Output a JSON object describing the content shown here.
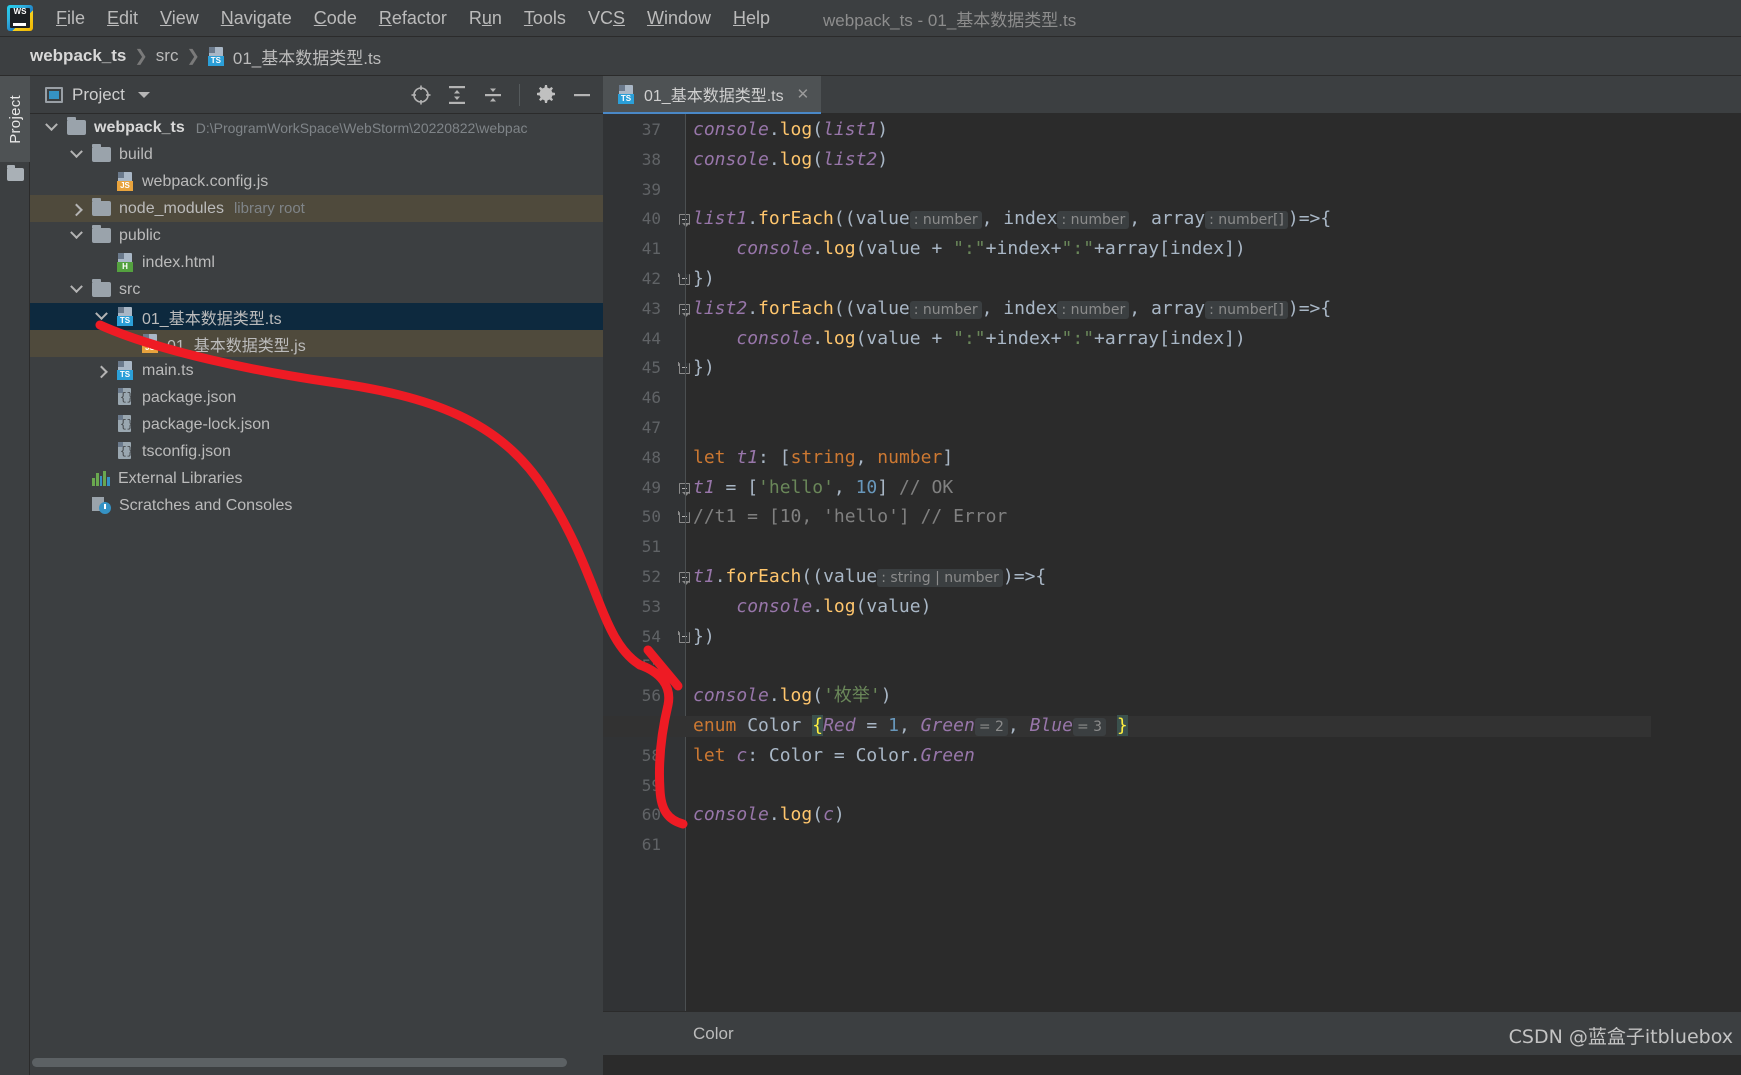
{
  "window": {
    "title": "webpack_ts - 01_基本数据类型.ts",
    "logo_text": "WS"
  },
  "menubar": {
    "items": [
      {
        "label": "File",
        "accel": "F"
      },
      {
        "label": "Edit",
        "accel": "E"
      },
      {
        "label": "View",
        "accel": "V"
      },
      {
        "label": "Navigate",
        "accel": "N"
      },
      {
        "label": "Code",
        "accel": "C"
      },
      {
        "label": "Refactor",
        "accel": "R"
      },
      {
        "label": "Run",
        "accel": "u"
      },
      {
        "label": "Tools",
        "accel": "T"
      },
      {
        "label": "VCS",
        "accel": "S"
      },
      {
        "label": "Window",
        "accel": "W"
      },
      {
        "label": "Help",
        "accel": "H"
      }
    ]
  },
  "breadcrumb": {
    "project": "webpack_ts",
    "folder": "src",
    "file": "01_基本数据类型.ts",
    "separator": "❯"
  },
  "tool_stripe": {
    "project_tab": "Project"
  },
  "project_panel": {
    "title": "Project",
    "tree": [
      {
        "indent": 0,
        "arrow": "down",
        "icon": "folder",
        "label": "webpack_ts",
        "bold": true,
        "path": "D:\\ProgramWorkSpace\\WebStorm\\20220822\\webpac",
        "state": "normal"
      },
      {
        "indent": 1,
        "arrow": "down",
        "icon": "folder",
        "label": "build",
        "bold": false,
        "state": "normal"
      },
      {
        "indent": 2,
        "arrow": "none",
        "icon": "js",
        "label": "webpack.config.js",
        "bold": false,
        "state": "normal"
      },
      {
        "indent": 1,
        "arrow": "right",
        "icon": "folder",
        "label": "node_modules",
        "bold": false,
        "sublabel": "library root",
        "state": "ghost"
      },
      {
        "indent": 1,
        "arrow": "down",
        "icon": "folder",
        "label": "public",
        "bold": false,
        "state": "normal"
      },
      {
        "indent": 2,
        "arrow": "none",
        "icon": "html",
        "label": "index.html",
        "bold": false,
        "state": "normal"
      },
      {
        "indent": 1,
        "arrow": "down",
        "icon": "folder",
        "label": "src",
        "bold": false,
        "state": "normal"
      },
      {
        "indent": 2,
        "arrow": "down",
        "icon": "ts",
        "label": "01_基本数据类型.ts",
        "bold": false,
        "state": "selected"
      },
      {
        "indent": 3,
        "arrow": "none",
        "icon": "js",
        "label": "01_基本数据类型.js",
        "bold": false,
        "state": "ghost"
      },
      {
        "indent": 2,
        "arrow": "right",
        "icon": "ts",
        "label": "main.ts",
        "bold": false,
        "state": "normal"
      },
      {
        "indent": 2,
        "arrow": "none",
        "icon": "json",
        "label": "package.json",
        "bold": false,
        "state": "normal"
      },
      {
        "indent": 2,
        "arrow": "none",
        "icon": "json",
        "label": "package-lock.json",
        "bold": false,
        "state": "normal"
      },
      {
        "indent": 2,
        "arrow": "none",
        "icon": "json",
        "label": "tsconfig.json",
        "bold": false,
        "state": "normal"
      },
      {
        "indent": 1,
        "arrow": "none",
        "icon": "extlib",
        "label": "External Libraries",
        "bold": false,
        "state": "normal"
      },
      {
        "indent": 1,
        "arrow": "none",
        "icon": "scratch",
        "label": "Scratches and Consoles",
        "bold": false,
        "state": "normal"
      }
    ],
    "toolbar_icons": [
      {
        "name": "locate-icon"
      },
      {
        "name": "expand-all-icon"
      },
      {
        "name": "collapse-all-icon"
      },
      {
        "name": "settings-gear-icon"
      },
      {
        "name": "hide-panel-icon"
      }
    ]
  },
  "editor": {
    "tab": {
      "label": "01_基本数据类型.ts",
      "close": "✕",
      "icon": "ts"
    },
    "first_line": 37,
    "current_line": 57,
    "last_line": 61,
    "bottom_breadcrumb": "Color",
    "watermark": "CSDN @蓝盒子itbluebox",
    "lines": [
      {
        "n": 37,
        "fold": "none",
        "tokens": [
          {
            "t": "console",
            "c": "inst"
          },
          {
            "t": ".",
            "c": "punct"
          },
          {
            "t": "log",
            "c": "fn"
          },
          {
            "t": "(",
            "c": "punct"
          },
          {
            "t": "list1",
            "c": "var"
          },
          {
            "t": ")",
            "c": "punct"
          }
        ]
      },
      {
        "n": 38,
        "fold": "none",
        "tokens": [
          {
            "t": "console",
            "c": "inst"
          },
          {
            "t": ".",
            "c": "punct"
          },
          {
            "t": "log",
            "c": "fn"
          },
          {
            "t": "(",
            "c": "punct"
          },
          {
            "t": "list2",
            "c": "var"
          },
          {
            "t": ")",
            "c": "punct"
          }
        ]
      },
      {
        "n": 39,
        "fold": "none",
        "tokens": []
      },
      {
        "n": 40,
        "fold": "open",
        "tokens": [
          {
            "t": "list1",
            "c": "var"
          },
          {
            "t": ".",
            "c": "punct"
          },
          {
            "t": "forEach",
            "c": "fn"
          },
          {
            "t": "((",
            "c": "punct"
          },
          {
            "t": "value",
            "c": "id"
          },
          {
            "t": ": number",
            "c": "hint"
          },
          {
            "t": ", ",
            "c": "punct"
          },
          {
            "t": "index",
            "c": "id"
          },
          {
            "t": ": number",
            "c": "hint"
          },
          {
            "t": ", ",
            "c": "punct"
          },
          {
            "t": "array",
            "c": "id"
          },
          {
            "t": ": number[]",
            "c": "hint"
          },
          {
            "t": ")=>{",
            "c": "punct"
          }
        ]
      },
      {
        "n": 41,
        "fold": "none",
        "tokens": [
          {
            "t": "    ",
            "c": "punct"
          },
          {
            "t": "console",
            "c": "inst"
          },
          {
            "t": ".",
            "c": "punct"
          },
          {
            "t": "log",
            "c": "fn"
          },
          {
            "t": "(",
            "c": "punct"
          },
          {
            "t": "value",
            "c": "id"
          },
          {
            "t": " + ",
            "c": "punct"
          },
          {
            "t": "\":\"",
            "c": "str"
          },
          {
            "t": "+",
            "c": "punct"
          },
          {
            "t": "index",
            "c": "id"
          },
          {
            "t": "+",
            "c": "punct"
          },
          {
            "t": "\":\"",
            "c": "str"
          },
          {
            "t": "+",
            "c": "punct"
          },
          {
            "t": "array",
            "c": "id"
          },
          {
            "t": "[",
            "c": "punct"
          },
          {
            "t": "index",
            "c": "id"
          },
          {
            "t": "])",
            "c": "punct"
          }
        ]
      },
      {
        "n": 42,
        "fold": "end",
        "tokens": [
          {
            "t": "})",
            "c": "punct"
          }
        ]
      },
      {
        "n": 43,
        "fold": "open",
        "tokens": [
          {
            "t": "list2",
            "c": "var"
          },
          {
            "t": ".",
            "c": "punct"
          },
          {
            "t": "forEach",
            "c": "fn"
          },
          {
            "t": "((",
            "c": "punct"
          },
          {
            "t": "value",
            "c": "id"
          },
          {
            "t": ": number",
            "c": "hint"
          },
          {
            "t": ", ",
            "c": "punct"
          },
          {
            "t": "index",
            "c": "id"
          },
          {
            "t": ": number",
            "c": "hint"
          },
          {
            "t": ", ",
            "c": "punct"
          },
          {
            "t": "array",
            "c": "id"
          },
          {
            "t": ": number[]",
            "c": "hint"
          },
          {
            "t": ")=>{",
            "c": "punct"
          }
        ]
      },
      {
        "n": 44,
        "fold": "none",
        "tokens": [
          {
            "t": "    ",
            "c": "punct"
          },
          {
            "t": "console",
            "c": "inst"
          },
          {
            "t": ".",
            "c": "punct"
          },
          {
            "t": "log",
            "c": "fn"
          },
          {
            "t": "(",
            "c": "punct"
          },
          {
            "t": "value",
            "c": "id"
          },
          {
            "t": " + ",
            "c": "punct"
          },
          {
            "t": "\":\"",
            "c": "str"
          },
          {
            "t": "+",
            "c": "punct"
          },
          {
            "t": "index",
            "c": "id"
          },
          {
            "t": "+",
            "c": "punct"
          },
          {
            "t": "\":\"",
            "c": "str"
          },
          {
            "t": "+",
            "c": "punct"
          },
          {
            "t": "array",
            "c": "id"
          },
          {
            "t": "[",
            "c": "punct"
          },
          {
            "t": "index",
            "c": "id"
          },
          {
            "t": "])",
            "c": "punct"
          }
        ]
      },
      {
        "n": 45,
        "fold": "end",
        "tokens": [
          {
            "t": "})",
            "c": "punct"
          }
        ]
      },
      {
        "n": 46,
        "fold": "none",
        "tokens": []
      },
      {
        "n": 47,
        "fold": "none",
        "tokens": []
      },
      {
        "n": 48,
        "fold": "none",
        "tokens": [
          {
            "t": "let ",
            "c": "kw"
          },
          {
            "t": "t1",
            "c": "var"
          },
          {
            "t": ": [",
            "c": "punct"
          },
          {
            "t": "string",
            "c": "kw"
          },
          {
            "t": ", ",
            "c": "punct"
          },
          {
            "t": "number",
            "c": "kw"
          },
          {
            "t": "]",
            "c": "punct"
          }
        ]
      },
      {
        "n": 49,
        "fold": "open",
        "tokens": [
          {
            "t": "t1",
            "c": "var"
          },
          {
            "t": " = [",
            "c": "punct"
          },
          {
            "t": "'hello'",
            "c": "str"
          },
          {
            "t": ", ",
            "c": "punct"
          },
          {
            "t": "10",
            "c": "num"
          },
          {
            "t": "] ",
            "c": "punct"
          },
          {
            "t": "// OK",
            "c": "cmt"
          }
        ]
      },
      {
        "n": 50,
        "fold": "end",
        "tokens": [
          {
            "t": "//t1 = [10, 'hello'] // Error",
            "c": "cmt"
          }
        ]
      },
      {
        "n": 51,
        "fold": "none",
        "tokens": []
      },
      {
        "n": 52,
        "fold": "open",
        "tokens": [
          {
            "t": "t1",
            "c": "var"
          },
          {
            "t": ".",
            "c": "punct"
          },
          {
            "t": "forEach",
            "c": "fn"
          },
          {
            "t": "((",
            "c": "punct"
          },
          {
            "t": "value",
            "c": "id"
          },
          {
            "t": ": string | number",
            "c": "hint"
          },
          {
            "t": ")=>{",
            "c": "punct"
          }
        ]
      },
      {
        "n": 53,
        "fold": "none",
        "tokens": [
          {
            "t": "    ",
            "c": "punct"
          },
          {
            "t": "console",
            "c": "inst"
          },
          {
            "t": ".",
            "c": "punct"
          },
          {
            "t": "log",
            "c": "fn"
          },
          {
            "t": "(",
            "c": "punct"
          },
          {
            "t": "value",
            "c": "id"
          },
          {
            "t": ")",
            "c": "punct"
          }
        ]
      },
      {
        "n": 54,
        "fold": "end",
        "tokens": [
          {
            "t": "})",
            "c": "punct"
          }
        ]
      },
      {
        "n": 55,
        "fold": "none",
        "tokens": []
      },
      {
        "n": 56,
        "fold": "none",
        "tokens": [
          {
            "t": "console",
            "c": "inst"
          },
          {
            "t": ".",
            "c": "punct"
          },
          {
            "t": "log",
            "c": "fn"
          },
          {
            "t": "(",
            "c": "punct"
          },
          {
            "t": "'枚举'",
            "c": "str"
          },
          {
            "t": ")",
            "c": "punct"
          }
        ]
      },
      {
        "n": 57,
        "fold": "none",
        "current": true,
        "tokens": [
          {
            "t": "enum ",
            "c": "kw"
          },
          {
            "t": "Color",
            "c": "type"
          },
          {
            "t": " ",
            "c": "punct"
          },
          {
            "t": "{",
            "c": "brace"
          },
          {
            "t": "Red",
            "c": "var"
          },
          {
            "t": " = ",
            "c": "punct"
          },
          {
            "t": "1",
            "c": "num"
          },
          {
            "t": ", ",
            "c": "punct"
          },
          {
            "t": "Green",
            "c": "var"
          },
          {
            "t": "= 2",
            "c": "hint"
          },
          {
            "t": ", ",
            "c": "punct"
          },
          {
            "t": "Blue",
            "c": "var"
          },
          {
            "t": "= 3",
            "c": "hint"
          },
          {
            "t": " ",
            "c": "punct"
          },
          {
            "t": "}",
            "c": "brace"
          }
        ]
      },
      {
        "n": 58,
        "fold": "none",
        "tokens": [
          {
            "t": "let ",
            "c": "kw"
          },
          {
            "t": "c",
            "c": "var"
          },
          {
            "t": ": ",
            "c": "punct"
          },
          {
            "t": "Color",
            "c": "type"
          },
          {
            "t": " = ",
            "c": "punct"
          },
          {
            "t": "Color",
            "c": "type"
          },
          {
            "t": ".",
            "c": "punct"
          },
          {
            "t": "Green",
            "c": "var"
          }
        ]
      },
      {
        "n": 59,
        "fold": "none",
        "tokens": []
      },
      {
        "n": 60,
        "fold": "none",
        "tokens": [
          {
            "t": "console",
            "c": "inst"
          },
          {
            "t": ".",
            "c": "punct"
          },
          {
            "t": "log",
            "c": "fn"
          },
          {
            "t": "(",
            "c": "punct"
          },
          {
            "t": "c",
            "c": "var"
          },
          {
            "t": ")",
            "c": "punct"
          }
        ]
      },
      {
        "n": 61,
        "fold": "none",
        "tokens": []
      }
    ]
  },
  "annotation": {
    "color": "#ee1b24",
    "description": "red hand-drawn arrow from tree js file to enum line"
  },
  "colors": {
    "accent": "#3592c4",
    "selected_row": "#0d293e",
    "ghost_row": "#4f4a3c",
    "editor_bg": "#2b2b2b",
    "panel_bg": "#3c3f41",
    "gutter_bg": "#313335"
  }
}
